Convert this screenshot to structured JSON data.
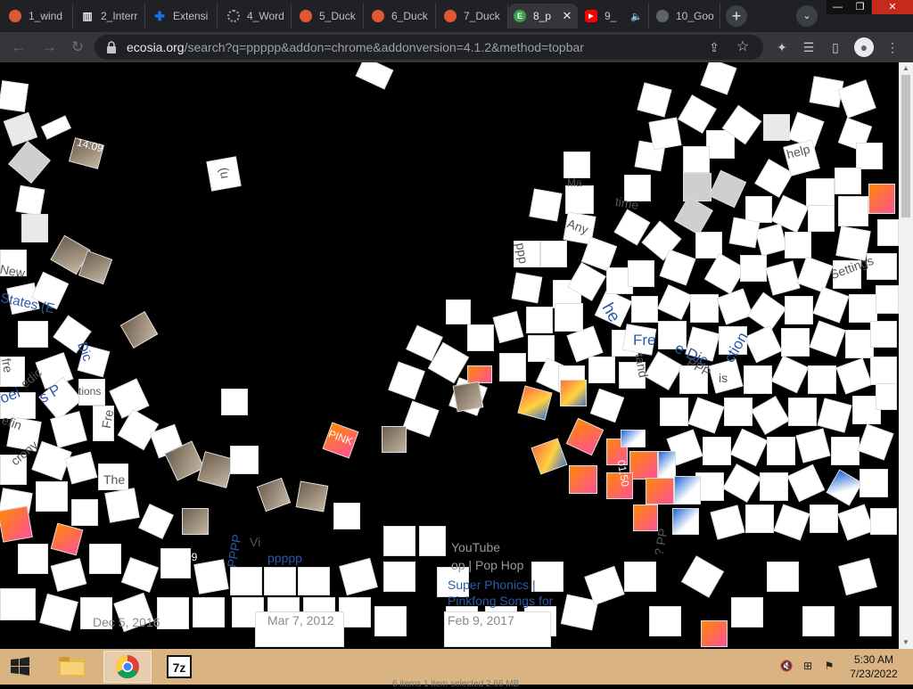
{
  "browser": {
    "tabs": [
      {
        "title": "1_wind",
        "icon": "duckduckgo-icon",
        "color": "#de5833"
      },
      {
        "title": "2_Interr",
        "icon": "archive-icon",
        "color": "#8ab4f8"
      },
      {
        "title": "Extensi",
        "icon": "puzzle-icon",
        "color": "#1a73e8"
      },
      {
        "title": "4_Word",
        "icon": "loading-spinner-icon",
        "color": "#9aa0a6"
      },
      {
        "title": "5_Duck",
        "icon": "duckduckgo-icon",
        "color": "#de5833"
      },
      {
        "title": "6_Duck",
        "icon": "duckduckgo-icon",
        "color": "#de5833"
      },
      {
        "title": "7_Duck",
        "icon": "duckduckgo-icon",
        "color": "#de5833"
      },
      {
        "title": "8_p",
        "icon": "ecosia-icon",
        "color": "#3c9f4f",
        "active": true
      },
      {
        "title": "9_",
        "icon": "youtube-icon",
        "color": "#ff0000"
      },
      {
        "title": "10_Goo",
        "icon": "google-icon",
        "color": "#5f6368"
      }
    ],
    "window_controls": {
      "minimize": "—",
      "restore": "❐",
      "close": "✕"
    },
    "url_host": "ecosia.org",
    "url_rest": "/search?q=ppppp&addon=chrome&addonversion=4.1.2&method=topbar"
  },
  "page": {
    "fragments": [
      {
        "text": "14:09",
        "cls": "small"
      },
      {
        "text": "(u",
        "cls": ""
      },
      {
        "text": "New",
        "cls": ""
      },
      {
        "text": "States (E",
        "cls": "blue"
      },
      {
        "text": "Dic",
        "cls": "blue"
      },
      {
        "text": "fre",
        "cls": ""
      },
      {
        "text": "edic",
        "cls": ""
      },
      {
        "text": "oei",
        "cls": "blue"
      },
      {
        "text": "s P",
        "cls": "blue"
      },
      {
        "text": "tions",
        "cls": ""
      },
      {
        "text": "efin",
        "cls": ""
      },
      {
        "text": "Fre",
        "cls": ""
      },
      {
        "text": "crony",
        "cls": ""
      },
      {
        "text": "The",
        "cls": ""
      },
      {
        "text": "ppp",
        "cls": ""
      },
      {
        "text": "Any",
        "cls": ""
      },
      {
        "text": "time",
        "cls": ""
      },
      {
        "text": "he",
        "cls": "blue"
      },
      {
        "text": "Fre",
        "cls": "blue"
      },
      {
        "text": "e Dic",
        "cls": "blue"
      },
      {
        "text": "ction",
        "cls": "blue"
      },
      {
        "text": "tand",
        "cls": ""
      },
      {
        "text": "PPP",
        "cls": ""
      },
      {
        "text": "is",
        "cls": ""
      },
      {
        "text": "Settings",
        "cls": ""
      },
      {
        "text": "help",
        "cls": ""
      },
      {
        "text": "Ma",
        "cls": ""
      },
      {
        "text": "PINK",
        "cls": "small"
      },
      {
        "text": "01:50",
        "cls": "small"
      },
      {
        "text": "Vi",
        "cls": ""
      },
      {
        "text": "ppppp",
        "cls": ""
      },
      {
        "text": "1:09",
        "cls": "small"
      },
      {
        "text": "YouTube",
        "cls": ""
      },
      {
        "text": "op | Pop Hop",
        "cls": ""
      },
      {
        "text": "Super Phonics |",
        "cls": "blue"
      },
      {
        "text": "Pinkfong Songs for",
        "cls": "blue"
      },
      {
        "text": "Feb 9, 2017",
        "cls": ""
      },
      {
        "text": "Mar 7, 2012",
        "cls": ""
      },
      {
        "text": "Dec 5, 2016",
        "cls": ""
      },
      {
        "text": "PPPP",
        "cls": ""
      },
      {
        "text": "? PP",
        "cls": ""
      }
    ]
  },
  "taskbar": {
    "apps": [
      {
        "name": "file-explorer",
        "label": "File Explorer"
      },
      {
        "name": "chrome",
        "label": "Google Chrome"
      },
      {
        "name": "7zip",
        "label": "7z"
      }
    ],
    "time": "5:30 AM",
    "date": "7/23/2022",
    "status_ghost": "6 items   1 item selected   2.66 MB"
  },
  "colors": {
    "tabstrip": "#202124",
    "toolbar": "#35363a",
    "taskbar": "#d9b382",
    "page_bg": "#000000"
  }
}
